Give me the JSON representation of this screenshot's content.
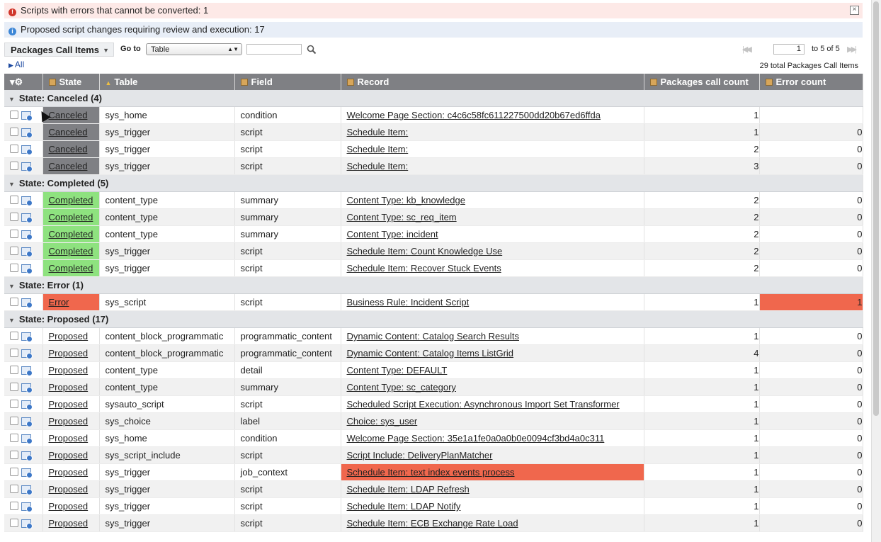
{
  "messages": {
    "error": "Scripts with errors that cannot be converted: 1",
    "info": "Proposed script changes requiring review and execution: 17"
  },
  "toolbar": {
    "list_title": "Packages Call Items",
    "goto_label": "Go to",
    "goto_value": "Table",
    "search_value": ""
  },
  "pager": {
    "page": "1",
    "of_text": "to 5 of 5"
  },
  "breadcrumb": {
    "all": "All"
  },
  "total": "29 total Packages Call Items",
  "columns": [
    "State",
    "Table",
    "Field",
    "Record",
    "Packages call count",
    "Error count"
  ],
  "colors": {
    "canceled": "#7f8084",
    "completed": "#8ee27f",
    "error": "#f0674d"
  },
  "groups": [
    {
      "label": "State: Canceled (4)",
      "rows": [
        {
          "state": "Canceled",
          "table": "sys_home",
          "field": "condition",
          "record": "Welcome Page Section: c4c6c58fc611227500dd20b67ed6ffda",
          "calls": "1",
          "errors": ""
        },
        {
          "state": "Canceled",
          "table": "sys_trigger",
          "field": "script",
          "record": "Schedule Item:",
          "calls": "1",
          "errors": "0"
        },
        {
          "state": "Canceled",
          "table": "sys_trigger",
          "field": "script",
          "record": "Schedule Item:",
          "calls": "2",
          "errors": "0"
        },
        {
          "state": "Canceled",
          "table": "sys_trigger",
          "field": "script",
          "record": "Schedule Item:",
          "calls": "3",
          "errors": "0"
        }
      ]
    },
    {
      "label": "State: Completed (5)",
      "rows": [
        {
          "state": "Completed",
          "table": "content_type",
          "field": "summary",
          "record": "Content Type: kb_knowledge",
          "calls": "2",
          "errors": "0"
        },
        {
          "state": "Completed",
          "table": "content_type",
          "field": "summary",
          "record": "Content Type: sc_req_item",
          "calls": "2",
          "errors": "0"
        },
        {
          "state": "Completed",
          "table": "content_type",
          "field": "summary",
          "record": "Content Type: incident",
          "calls": "2",
          "errors": "0"
        },
        {
          "state": "Completed",
          "table": "sys_trigger",
          "field": "script",
          "record": "Schedule Item: Count Knowledge Use",
          "calls": "2",
          "errors": "0"
        },
        {
          "state": "Completed",
          "table": "sys_trigger",
          "field": "script",
          "record": "Schedule Item: Recover Stuck Events",
          "calls": "2",
          "errors": "0"
        }
      ]
    },
    {
      "label": "State: Error (1)",
      "rows": [
        {
          "state": "Error",
          "table": "sys_script",
          "field": "script",
          "record": "Business Rule: Incident Script",
          "calls": "1",
          "errors": "1"
        }
      ]
    },
    {
      "label": "State: Proposed (17)",
      "rows": [
        {
          "state": "Proposed",
          "table": "content_block_programmatic",
          "field": "programmatic_content",
          "record": "Dynamic Content: Catalog Search Results",
          "calls": "1",
          "errors": "0"
        },
        {
          "state": "Proposed",
          "table": "content_block_programmatic",
          "field": "programmatic_content",
          "record": "Dynamic Content: Catalog Items ListGrid",
          "calls": "4",
          "errors": "0"
        },
        {
          "state": "Proposed",
          "table": "content_type",
          "field": "detail",
          "record": "Content Type: DEFAULT",
          "calls": "1",
          "errors": "0"
        },
        {
          "state": "Proposed",
          "table": "content_type",
          "field": "summary",
          "record": "Content Type: sc_category",
          "calls": "1",
          "errors": "0"
        },
        {
          "state": "Proposed",
          "table": "sysauto_script",
          "field": "script",
          "record": "Scheduled Script Execution: Asynchronous Import Set Transformer",
          "calls": "1",
          "errors": "0"
        },
        {
          "state": "Proposed",
          "table": "sys_choice",
          "field": "label",
          "record": "Choice: sys_user",
          "calls": "1",
          "errors": "0"
        },
        {
          "state": "Proposed",
          "table": "sys_home",
          "field": "condition",
          "record": "Welcome Page Section: 35e1a1fe0a0a0b0e0094cf3bd4a0c311",
          "calls": "1",
          "errors": "0"
        },
        {
          "state": "Proposed",
          "table": "sys_script_include",
          "field": "script",
          "record": "Script Include: DeliveryPlanMatcher",
          "calls": "1",
          "errors": "0"
        },
        {
          "state": "Proposed",
          "table": "sys_trigger",
          "field": "job_context",
          "record": "Schedule Item: text index events process",
          "calls": "1",
          "errors": "0",
          "record_highlight": true
        },
        {
          "state": "Proposed",
          "table": "sys_trigger",
          "field": "script",
          "record": "Schedule Item: LDAP Refresh",
          "calls": "1",
          "errors": "0"
        },
        {
          "state": "Proposed",
          "table": "sys_trigger",
          "field": "script",
          "record": "Schedule Item: LDAP Notify",
          "calls": "1",
          "errors": "0"
        },
        {
          "state": "Proposed",
          "table": "sys_trigger",
          "field": "script",
          "record": "Schedule Item: ECB Exchange Rate Load",
          "calls": "1",
          "errors": "0"
        }
      ]
    }
  ]
}
